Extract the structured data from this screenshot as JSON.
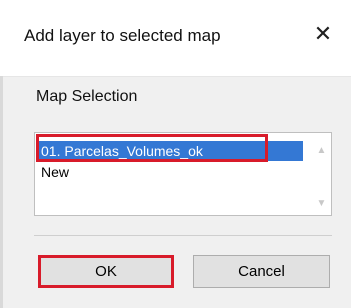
{
  "dialog": {
    "title": "Add layer to selected map",
    "close_glyph": "✕",
    "group_label": "Map Selection",
    "list_items": [
      "01. Parcelas_Volumes_ok",
      "New"
    ],
    "selected_index": 0,
    "scroll_up_glyph": "▲",
    "scroll_down_glyph": "▼",
    "ok_label": "OK",
    "cancel_label": "Cancel"
  },
  "colors": {
    "selection": "#3478d4",
    "highlight_outline": "#d81b2a",
    "button_face": "#e1e1e1",
    "dialog_background": "#f0f0f0"
  },
  "icons": {
    "close": "close-icon",
    "scroll_up": "chevron-up-icon",
    "scroll_down": "chevron-down-icon"
  }
}
